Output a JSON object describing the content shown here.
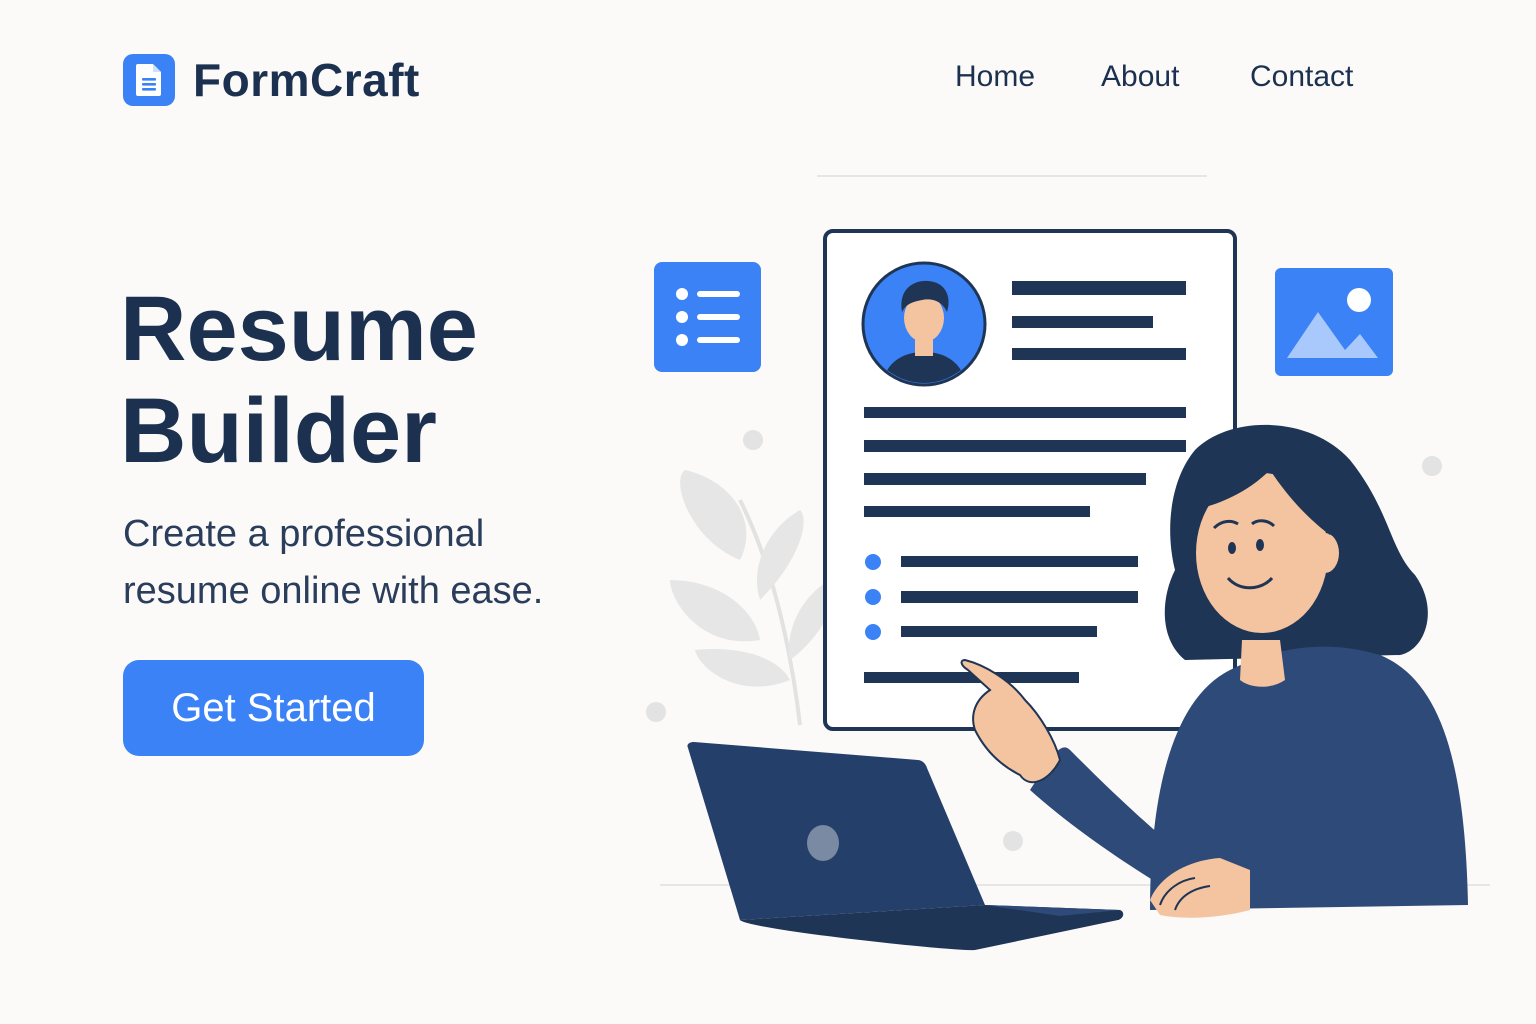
{
  "brand": {
    "name": "FormCraft",
    "icon": "document-icon",
    "accent_color": "#3b82f6"
  },
  "nav": {
    "items": [
      {
        "label": "Home"
      },
      {
        "label": "About"
      },
      {
        "label": "Contact"
      }
    ]
  },
  "hero": {
    "title_line1": "Resume",
    "title_line2": "Builder",
    "subtitle_line1": "Create a professional",
    "subtitle_line2": "resume online with ease.",
    "cta_label": "Get Started"
  },
  "colors": {
    "background": "#fbfaf8",
    "text_dark": "#1c3150",
    "accent": "#3b82f6",
    "navy": "#24406a"
  },
  "illustration": {
    "icons": [
      "list-icon",
      "image-icon",
      "avatar-icon"
    ],
    "subject": "woman pointing at resume document beside laptop"
  }
}
